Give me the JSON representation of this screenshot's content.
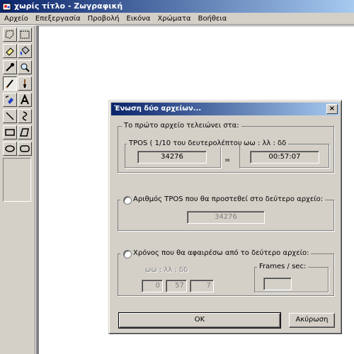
{
  "window": {
    "title": "χωρίς τίτλο - Ζωγραφική"
  },
  "menu": [
    "Αρχείο",
    "Επεξεργασία",
    "Προβολή",
    "Εικόνα",
    "Χρώματα",
    "Βοήθεια"
  ],
  "toolbox": {
    "tools": [
      "free-select-icon",
      "rect-select-icon",
      "eraser-icon",
      "fill-icon",
      "color-picker-icon",
      "magnifier-icon",
      "pencil-icon",
      "brush-icon",
      "airbrush-icon",
      "text-icon",
      "line-icon",
      "curve-icon",
      "rectangle-icon",
      "polygon-icon",
      "ellipse-icon",
      "rounded-rect-icon"
    ],
    "active_tool": "pencil-icon"
  },
  "dialog": {
    "title": "Ένωση δύο αρχείων...",
    "close_label": "×",
    "group1": {
      "legend": "Το πρώτο αρχείο τελειώνει στα:",
      "tpos_legend": "TPOS ( 1/10 του δευτερολέπτου)",
      "time_legend": "ωω  :  λλ  :  δδ",
      "tpos_value": "34276",
      "equals": "=",
      "time_value": "00:57:07"
    },
    "group2": {
      "legend": "Αριθμός TPOS που θα προστεθεί στο δεύτερο αρχείο:",
      "value": "34276"
    },
    "group3": {
      "legend": "Χρόνος που θα αφαιρέσω από το δεύτερο αρχείο:",
      "time_header": "ωω  :  λλ  :  δδ",
      "hours": "0",
      "minutes": "57",
      "seconds": "7",
      "fps_legend": "Frames / sec:",
      "fps_value": ""
    },
    "ok_label": "OK",
    "cancel_label": "Ακύρωση"
  }
}
